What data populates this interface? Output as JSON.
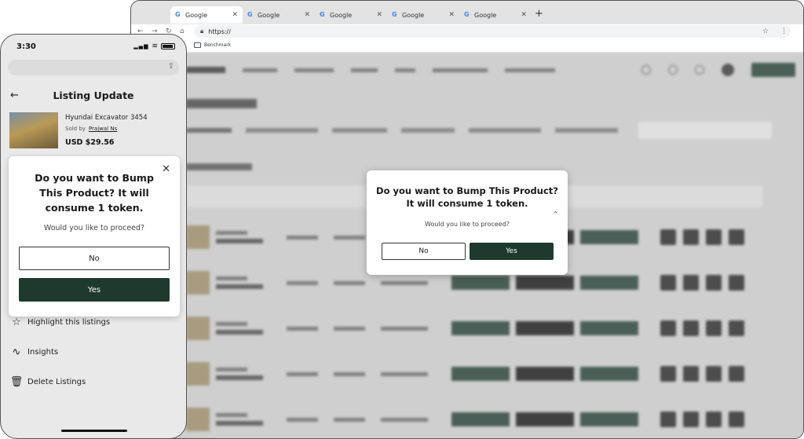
{
  "browser": {
    "tabs": [
      {
        "label": "Google",
        "icon": "google-icon"
      },
      {
        "label": "Google",
        "icon": "google-icon"
      },
      {
        "label": "Google",
        "icon": "google-icon"
      },
      {
        "label": "Google",
        "icon": "google-icon"
      },
      {
        "label": "Google",
        "icon": "google-icon"
      }
    ],
    "url": "https://",
    "bookmark": "Benchmark"
  },
  "desktop_dialog": {
    "question": "Do you want to Bump This Product? It will consume 1 token.",
    "prompt": "Would you like to proceed?",
    "no_label": "No",
    "yes_label": "Yes"
  },
  "phone": {
    "time": "3:30",
    "title": "Listing Update",
    "product": {
      "name": "Hyundai Excavator 3454",
      "sold_by_label": "Sold by",
      "seller": "Prajwal Ns",
      "price": "USD $29.56"
    },
    "dialog": {
      "question": "Do you want to Bump This Product? It will consume 1 token.",
      "prompt": "Would you like to proceed?",
      "no_label": "No",
      "yes_label": "Yes"
    },
    "menu": [
      {
        "label": "Highlight this listings",
        "icon": "star-icon"
      },
      {
        "label": "Insights",
        "icon": "chart-icon"
      },
      {
        "label": "Delete Listings",
        "icon": "trash-icon"
      }
    ]
  },
  "colors": {
    "primary": "#1e3a2f",
    "overlay": "#e9e9e9"
  }
}
